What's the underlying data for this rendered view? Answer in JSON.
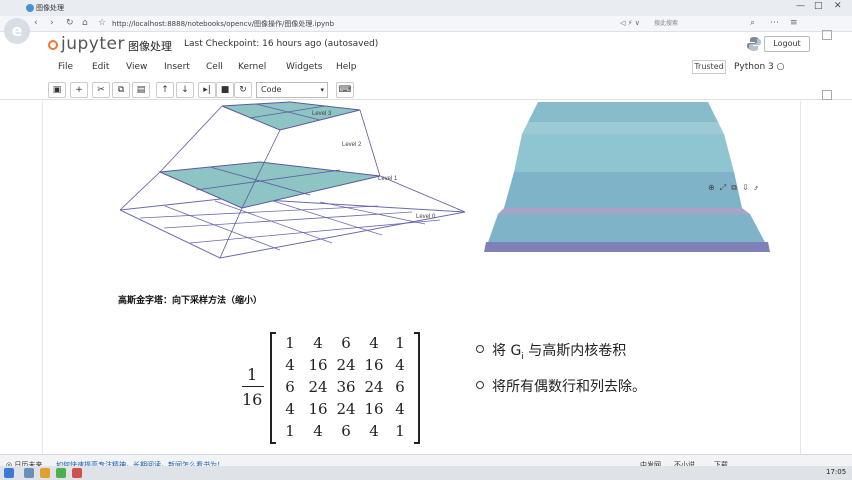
{
  "browser": {
    "tab_title": "图像处理",
    "url": "http://localhost:8888/notebooks/opencv/图像操作/图像处理.ipynb",
    "search_placeholder": "搜此搜索"
  },
  "jupyter": {
    "logo_text": "jupyter",
    "notebook_title": "图像处理",
    "checkpoint": "Last Checkpoint: 16 hours ago (autosaved)",
    "logout_label": "Logout",
    "menu": [
      "File",
      "Edit",
      "View",
      "Insert",
      "Cell",
      "Kernel",
      "Widgets",
      "Help"
    ],
    "trusted_label": "Trusted",
    "kernel_label": "Python 3",
    "cell_type": "Code"
  },
  "figure": {
    "pyramid_labels": [
      "Level 3",
      "Level 2",
      "Level 1",
      "Level 0"
    ]
  },
  "content": {
    "caption": "高斯金字塔：向下采样方法（缩小）",
    "fraction_num": "1",
    "fraction_den": "16",
    "matrix": [
      [
        "1",
        "4",
        "6",
        "4",
        "1"
      ],
      [
        "4",
        "16",
        "24",
        "16",
        "4"
      ],
      [
        "6",
        "24",
        "36",
        "24",
        "6"
      ],
      [
        "4",
        "16",
        "24",
        "16",
        "4"
      ],
      [
        "1",
        "4",
        "6",
        "4",
        "1"
      ]
    ],
    "bullet_1_pre": "将 G",
    "bullet_1_sub": "i",
    "bullet_1_post": " 与高斯内核卷积",
    "bullet_2": "将所有偶数行和列去除。"
  },
  "taskbar": {
    "left_text": "◎ 日历未来",
    "link_text": "如何快速提高专注精神，长期阅读，新闻怎么看书为！",
    "right_items": [
      "中发网",
      "不小说",
      "下载"
    ],
    "clock": "17:05"
  },
  "colors": {
    "pyramid_fill": "#8fc4c4",
    "pyramid_line": "#5a5aa0",
    "render_fill": "#7fb3c8",
    "render_band": "#7a86b0",
    "jupyter_orange": "#f37726"
  }
}
